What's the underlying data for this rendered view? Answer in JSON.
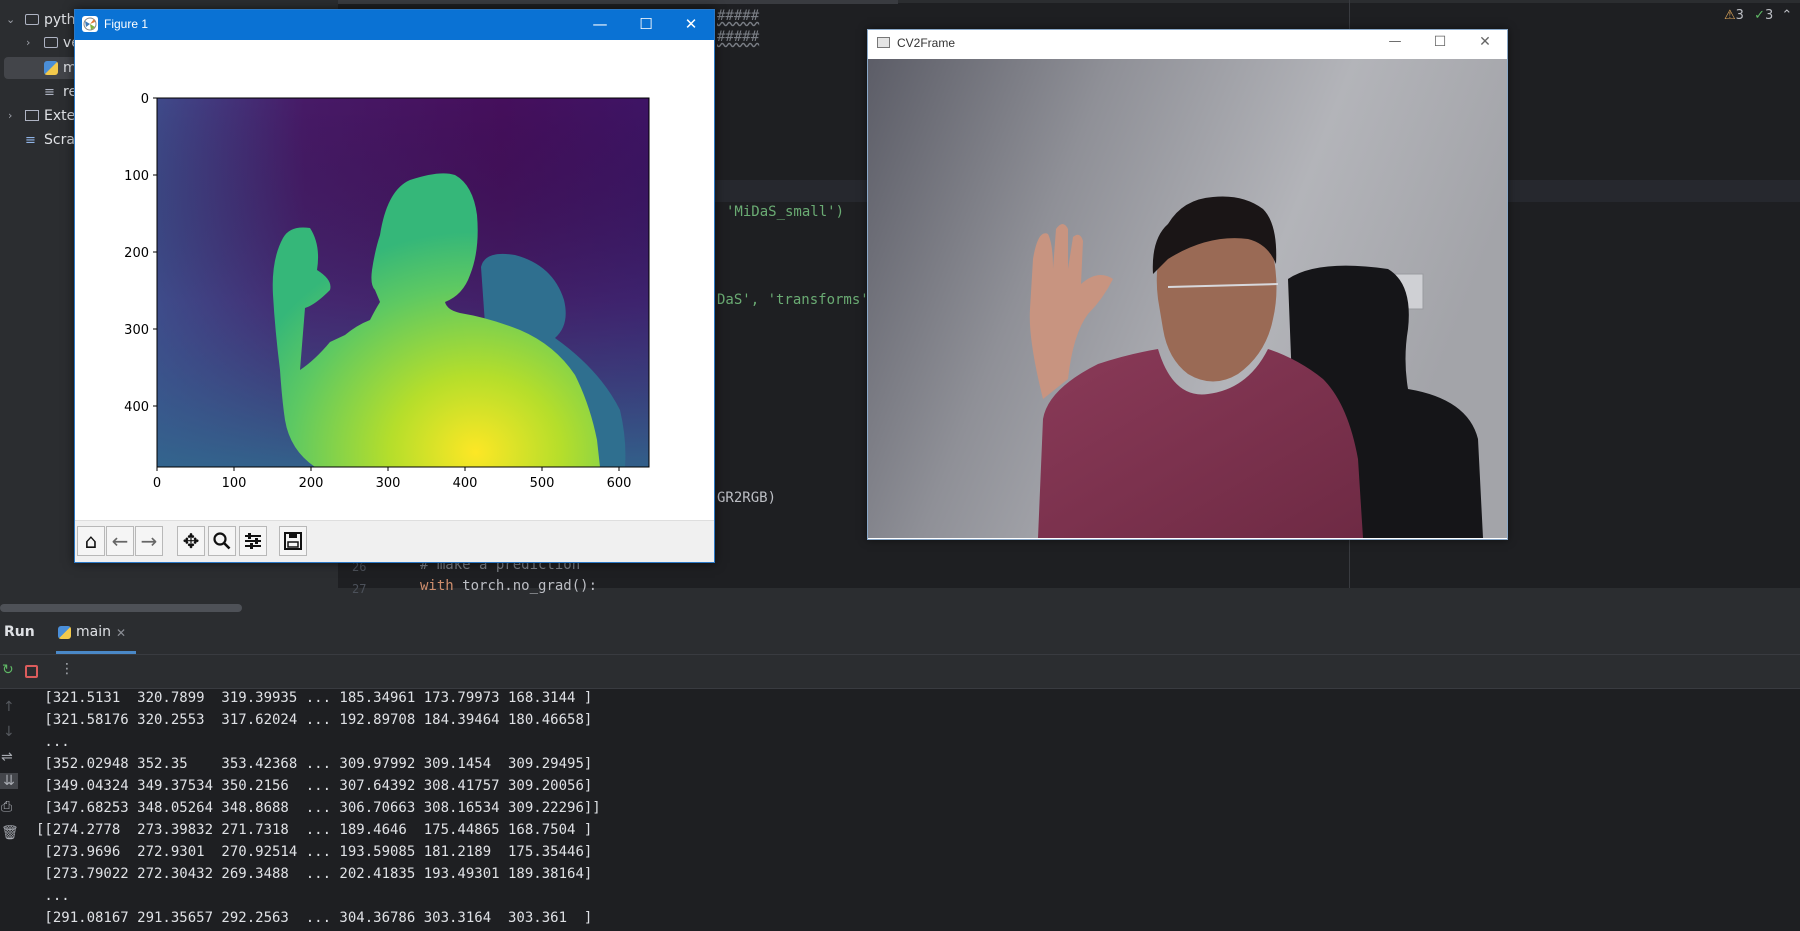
{
  "project_tree": {
    "items": [
      {
        "label": "pytho",
        "chevron": "⌄"
      },
      {
        "label": "ve",
        "chevron": "›"
      },
      {
        "label": "m"
      },
      {
        "label": "re"
      },
      {
        "label": "Exter",
        "chevron": "›"
      },
      {
        "label": "Scrat"
      }
    ]
  },
  "editor": {
    "lines": [
      {
        "text": "#####"
      },
      {
        "text": "#####"
      },
      {
        "text": "'MiDaS_small')"
      },
      {
        "text_a": "DaS', ",
        "text_b": "'transforms'",
        "text_c": ")"
      },
      {
        "text": "GR2RGB)"
      },
      {
        "gutter": "26",
        "text": "# make a prediction"
      },
      {
        "gutter": "27",
        "kw": "with ",
        "text": "torch.no_grad():"
      }
    ]
  },
  "inspections": {
    "warnings": "3",
    "ok": "3"
  },
  "figure_window": {
    "title": "Figure 1",
    "plot": {
      "x_ticks": [
        "0",
        "100",
        "200",
        "300",
        "400",
        "500",
        "600"
      ],
      "y_ticks": [
        "0",
        "100",
        "200",
        "300",
        "400"
      ],
      "colormap": [
        "#440154",
        "#3b528b",
        "#21918c",
        "#5ec962",
        "#fde725"
      ]
    },
    "toolbar": [
      "home-icon",
      "back-icon",
      "forward-icon",
      "pan-icon",
      "zoom-icon",
      "configure-icon",
      "save-icon"
    ]
  },
  "cv_window": {
    "title": "CV2Frame"
  },
  "run": {
    "title": "Run",
    "tab_label": "main",
    "output_lines": [
      " [321.5131  320.7899  319.39935 ... 185.34961 173.79973 168.3144 ]",
      " [321.58176 320.2553  317.62024 ... 192.89708 184.39464 180.46658]",
      " ...",
      " [352.02948 352.35    353.42368 ... 309.97992 309.1454  309.29495]",
      " [349.04324 349.37534 350.2156  ... 307.64392 308.41757 309.20056]",
      " [347.68253 348.05264 348.8688  ... 306.70663 308.16534 309.22296]]",
      "[[274.2778  273.39832 271.7318  ... 189.4646  175.44865 168.7504 ]",
      " [273.9696  272.9301  270.92514 ... 193.59085 181.2189  175.35446]",
      " [273.79022 272.30432 269.3488  ... 202.41835 193.49301 189.38164]",
      " ...",
      " [291.08167 291.35657 292.2563  ... 304.36786 303.3164  303.361  ]"
    ]
  }
}
